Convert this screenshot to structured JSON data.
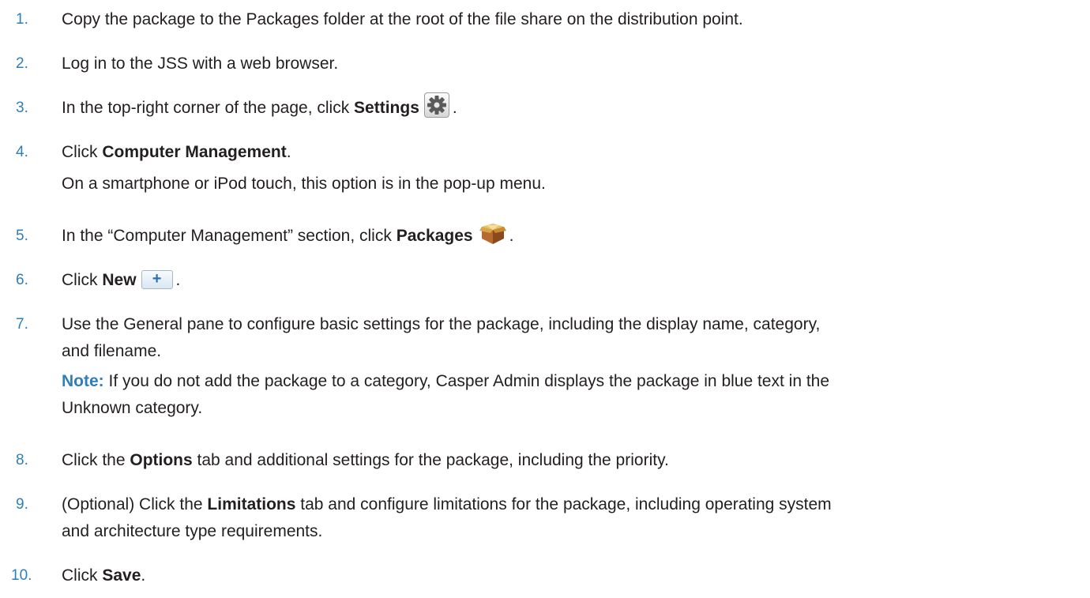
{
  "steps": [
    {
      "number": "1.",
      "text": "Copy the package to the Packages folder at the root of the file share on the distribution point."
    },
    {
      "number": "2.",
      "text": "Log in to the JSS with a web browser."
    },
    {
      "number": "3.",
      "pre": "In the top-right corner of the page, click ",
      "bold": "Settings",
      "post": ".",
      "icon": "gear-icon"
    },
    {
      "number": "4.",
      "pre": "Click ",
      "bold": "Computer Management",
      "post": ".",
      "sub": "On a smartphone or iPod touch, this option is in the pop-up menu."
    },
    {
      "number": "5.",
      "pre": "In the “Computer Management” section, click ",
      "bold": "Packages",
      "post": ".",
      "icon": "package-icon"
    },
    {
      "number": "6.",
      "pre": "Click ",
      "bold": "New",
      "post": ".",
      "icon": "plus-icon",
      "icon_glyph": "+"
    },
    {
      "number": "7.",
      "line1": "Use the General pane to configure basic settings for the package, including the display name, category,",
      "line2": "and filename.",
      "note_label": "Note:",
      "note_line1": " If you do not add the package to a category, Casper Admin displays the package in blue text in the",
      "note_line2": "Unknown category."
    },
    {
      "number": "8.",
      "pre": "Click the ",
      "bold": "Options",
      "post": " tab and additional settings for the package, including the priority."
    },
    {
      "number": "9.",
      "pre": "(Optional) Click the ",
      "bold": "Limitations",
      "post": " tab and configure limitations for the package, including operating system",
      "line2": "and architecture type requirements."
    },
    {
      "number": "10.",
      "pre": "Click ",
      "bold": "Save",
      "post": "."
    }
  ],
  "colors": {
    "number": "#2e7fb8",
    "text": "#231f20",
    "note": "#2e7fb8"
  }
}
